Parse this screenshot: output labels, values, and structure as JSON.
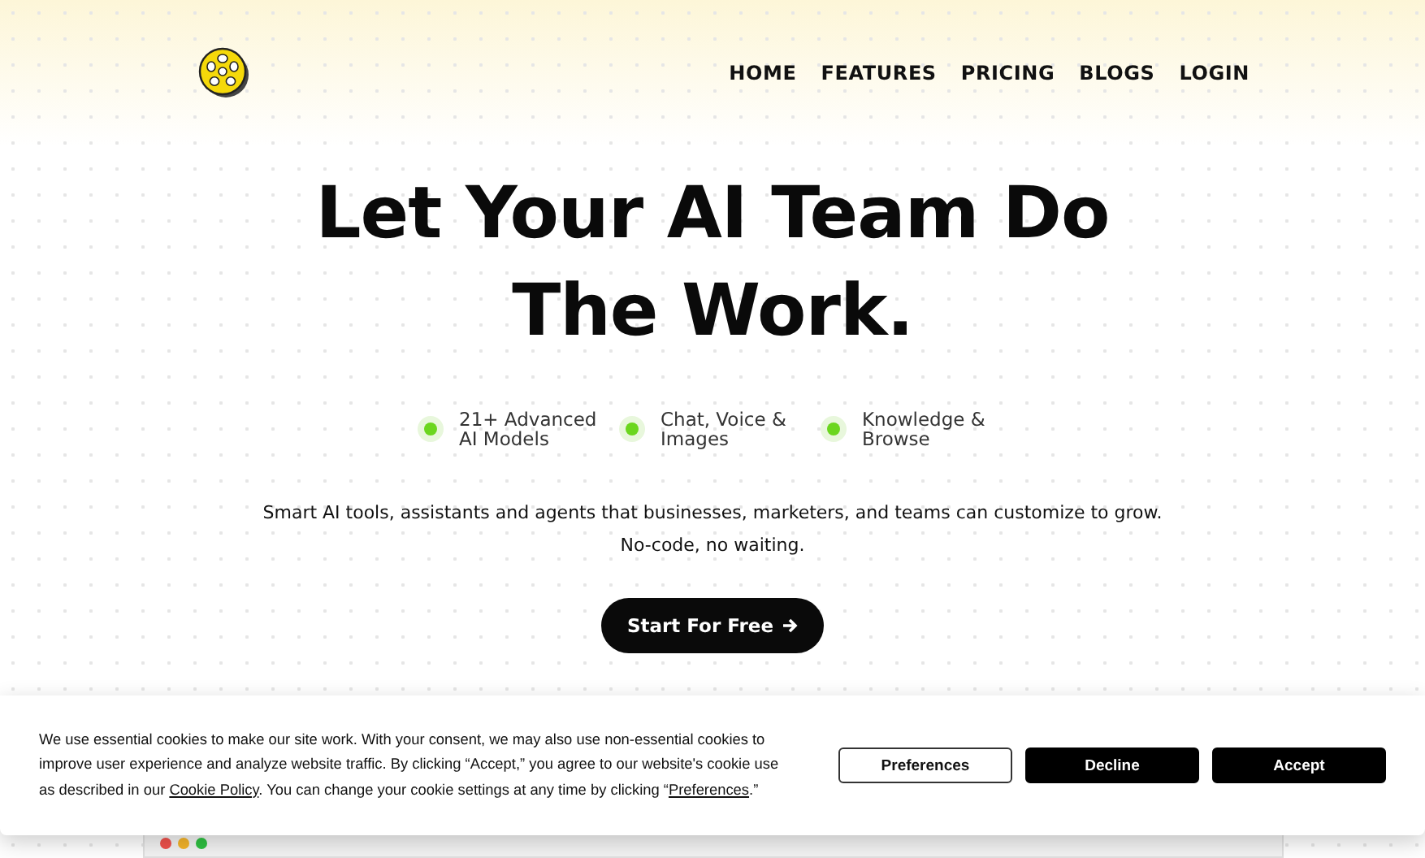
{
  "nav": {
    "links": [
      {
        "label": "HOME"
      },
      {
        "label": "FEATURES"
      },
      {
        "label": "PRICING"
      },
      {
        "label": "BLOGS"
      },
      {
        "label": "LOGIN"
      }
    ]
  },
  "hero": {
    "title": "Let Your AI Team Do The Work.",
    "features": [
      {
        "label": "21+ Advanced AI Models"
      },
      {
        "label": "Chat, Voice & Images"
      },
      {
        "label": "Knowledge & Browse"
      }
    ],
    "description": "Smart AI tools, assistants and agents that businesses, marketers, and teams can customize to grow. No-code, no waiting.",
    "cta": "Start For Free"
  },
  "cookie_banner": {
    "parts": [
      {
        "kind": "text",
        "text": "We use essential cookies to make our site work. With your consent, we may also use non-essential cookies to improve user experience and analyze website traffic. By clicking “Accept,” you agree to our website's cookie use as described in our "
      },
      {
        "kind": "link",
        "text": "Cookie Policy"
      },
      {
        "kind": "text",
        "text": ". You can change your cookie settings at any time by clicking “"
      },
      {
        "kind": "link",
        "text": "Preferences"
      },
      {
        "kind": "text",
        "text": ".”"
      }
    ],
    "buttons": [
      {
        "label": "Preferences",
        "kind": "outline"
      },
      {
        "label": "Decline",
        "kind": "solid"
      },
      {
        "label": "Accept",
        "kind": "solid"
      }
    ]
  }
}
